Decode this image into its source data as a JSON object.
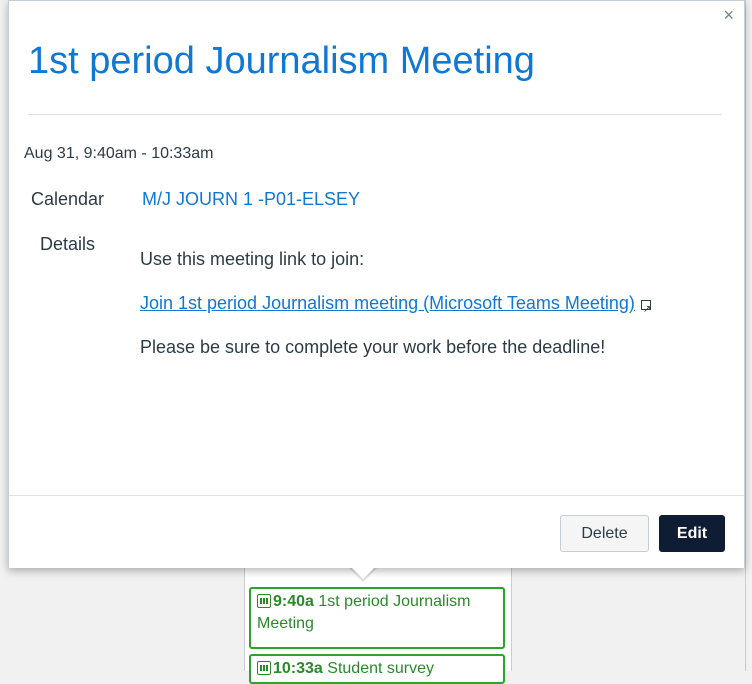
{
  "popover": {
    "title": "1st period Journalism Meeting",
    "close_label": "×",
    "time": "Aug 31, 9:40am - 10:33am",
    "calendar_label": "Calendar",
    "calendar_value": "M/J JOURN 1 -P01-ELSEY",
    "details_label": "Details",
    "details": {
      "line1": "Use this meeting link to join:",
      "link_text": "Join 1st period Journalism meeting (Microsoft Teams Meeting)",
      "line3": "Please be sure to complete your work before the deadline!"
    },
    "buttons": {
      "delete": "Delete",
      "edit": "Edit"
    }
  },
  "calendar_events": [
    {
      "time": "9:40a",
      "title": "1st period Journalism Meeting",
      "icon": "calendar-icon"
    },
    {
      "time": "10:33a",
      "title": "Student survey",
      "icon": "assignment-icon"
    }
  ],
  "colors": {
    "link": "#0f78d5",
    "event_green": "#2aa52a",
    "edit_button": "#0e1d33"
  }
}
